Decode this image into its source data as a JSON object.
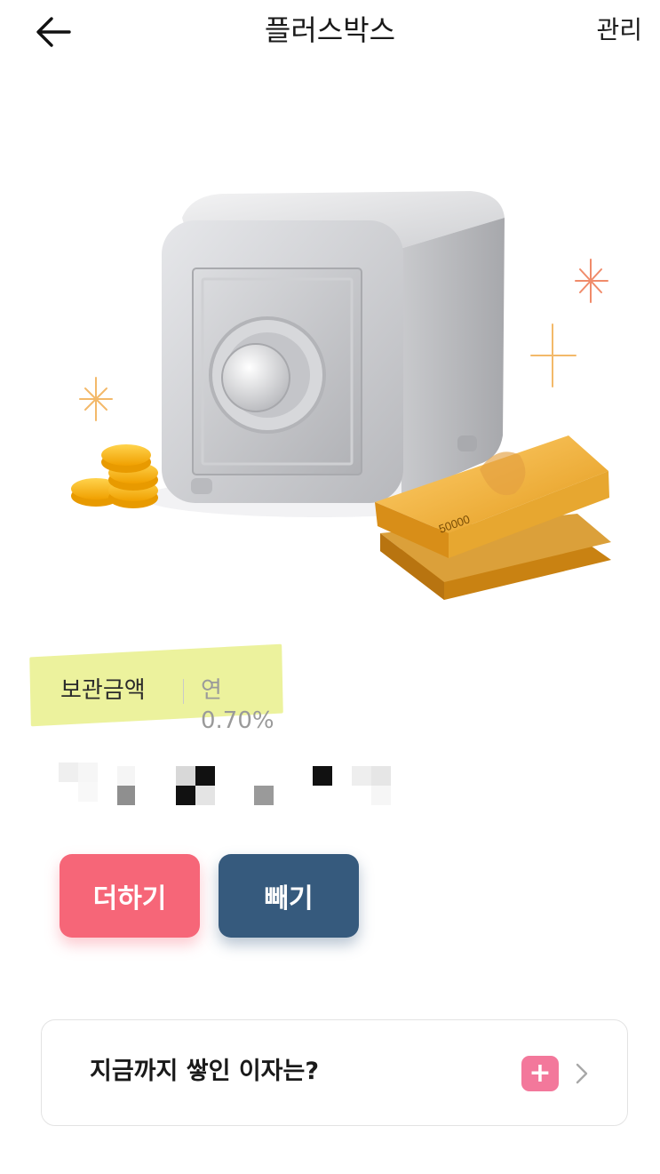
{
  "header": {
    "back_icon": "arrow-left-icon",
    "title": "플러스박스",
    "manage_label": "관리"
  },
  "hero": {
    "description_icon": "safe-with-coins-and-cash-illustration",
    "bill_text": "50000"
  },
  "balance": {
    "label": "보관금액",
    "rate": "연 0.70%"
  },
  "actions": {
    "add_label": "더하기",
    "withdraw_label": "빼기"
  },
  "interest": {
    "label": "지금까지 쌓인 이자는?",
    "badge_icon": "plus-icon",
    "badge_symbol": "+",
    "chevron_icon": "chevron-right-icon"
  },
  "colors": {
    "add_button": "#f66678",
    "withdraw_button": "#365a7d",
    "highlight": "#e9f08c",
    "badge": "#f3789b"
  }
}
